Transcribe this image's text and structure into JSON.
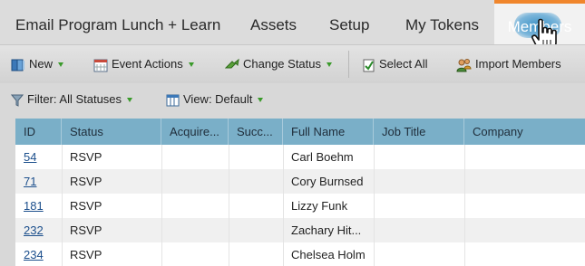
{
  "tabs": [
    {
      "label": "Email Program Lunch + Learn"
    },
    {
      "label": "Assets"
    },
    {
      "label": "Setup"
    },
    {
      "label": "My Tokens"
    },
    {
      "label": "Members"
    }
  ],
  "toolbar": {
    "new_label": "New",
    "event_actions_label": "Event Actions",
    "change_status_label": "Change Status",
    "select_all_label": "Select All",
    "import_members_label": "Import Members"
  },
  "filterbar": {
    "filter_label": "Filter: All Statuses",
    "view_label": "View: Default"
  },
  "grid": {
    "columns": [
      "ID",
      "Status",
      "Acquire...",
      "Succ...",
      "Full Name",
      "Job Title",
      "Company"
    ],
    "rows": [
      {
        "id": "54",
        "status": "RSVP",
        "acquired": "",
        "success": "",
        "full_name": "Carl Boehm",
        "job_title": "",
        "company": ""
      },
      {
        "id": "71",
        "status": "RSVP",
        "acquired": "",
        "success": "",
        "full_name": "Cory Burnsed",
        "job_title": "",
        "company": ""
      },
      {
        "id": "181",
        "status": "RSVP",
        "acquired": "",
        "success": "",
        "full_name": "Lizzy Funk",
        "job_title": "",
        "company": ""
      },
      {
        "id": "232",
        "status": "RSVP",
        "acquired": "",
        "success": "",
        "full_name": "Zachary Hit...",
        "job_title": "",
        "company": ""
      },
      {
        "id": "234",
        "status": "RSVP",
        "acquired": "",
        "success": "",
        "full_name": "Chelsea Holm",
        "job_title": "",
        "company": ""
      }
    ]
  },
  "colors": {
    "accent_tab_border": "#f0862c",
    "grid_header": "#7aafc8",
    "link": "#1c4f8c",
    "caret": "#3a9a2a"
  }
}
